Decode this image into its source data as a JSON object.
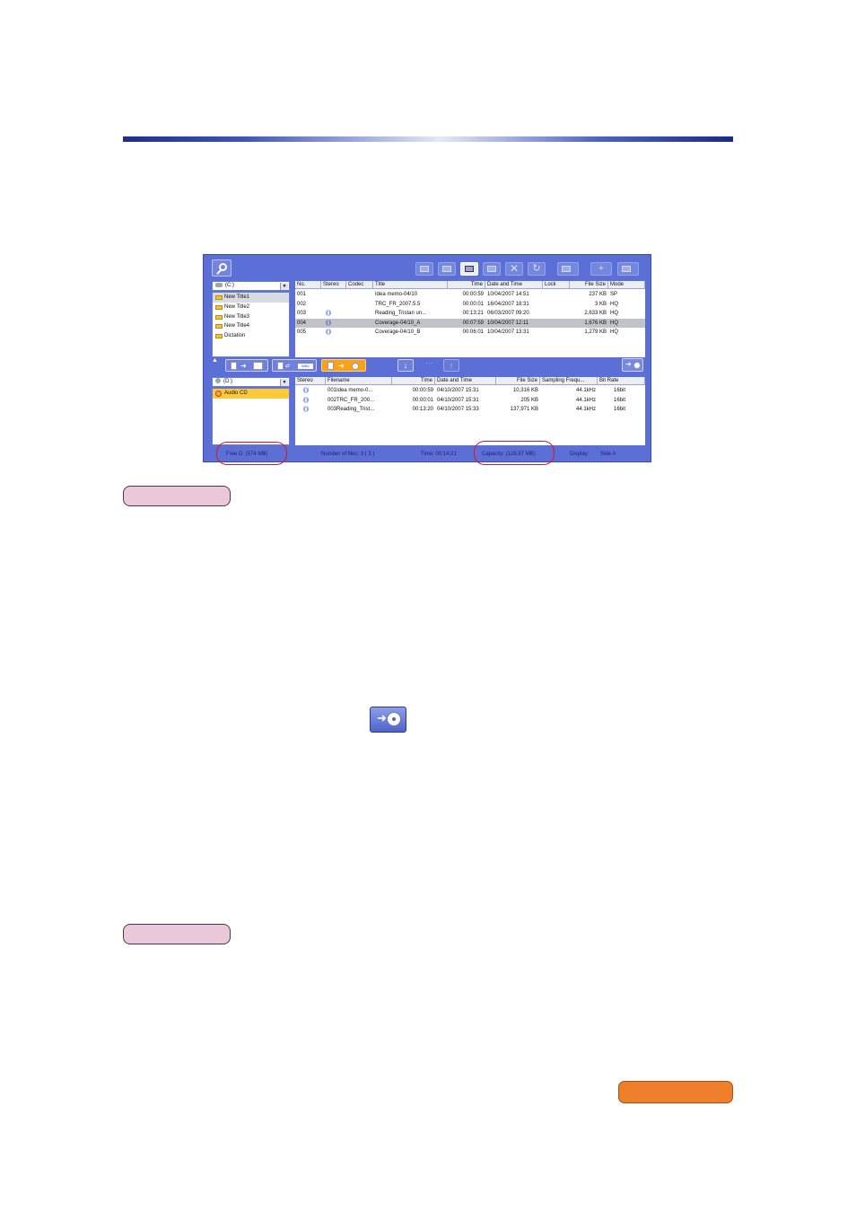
{
  "app": {
    "toolbar": {
      "search_icon": "search-icon",
      "buttons": [
        "copy-icon",
        "move-icon",
        "print-icon",
        "export-icon",
        "delete-icon",
        "refresh-icon",
        "split-icon",
        "add-icon",
        "title-icon"
      ]
    },
    "top": {
      "drive_label": "(C:)",
      "folders": [
        "New Title1",
        "New Title2",
        "New Title3",
        "New Title4",
        "Dictation"
      ],
      "columns": [
        "No.",
        "Stereo",
        "Codec",
        "Title",
        "Time",
        "Date and Time",
        "Lock",
        "File Size",
        "Mode"
      ],
      "rows": [
        {
          "no": "001",
          "stereo": "",
          "codec": "person",
          "title": "Idea memo-04/10",
          "time": "00:00:59",
          "date": "10/04/2007 14:51",
          "lock": "",
          "size": "237 KB",
          "mode": "SP",
          "selected": false
        },
        {
          "no": "002",
          "stereo": "",
          "codec": "bar",
          "title": "TRC_FR_2007.5.5",
          "time": "00:00:01",
          "date": "16/04/2007 18:31",
          "lock": "",
          "size": "3 KB",
          "mode": "HQ",
          "selected": false
        },
        {
          "no": "003",
          "stereo": "((·))",
          "codec": "bar",
          "title": "Reading_Tristan un...",
          "time": "00:13:21",
          "date": "06/03/2007 09:20",
          "lock": "",
          "size": "2,633 KB",
          "mode": "HQ",
          "selected": false
        },
        {
          "no": "004",
          "stereo": "((·))",
          "codec": "bar",
          "title": "Coverage-04/10_A",
          "time": "00:07:59",
          "date": "10/04/2007 12:11",
          "lock": "",
          "size": "1,676 KB",
          "mode": "HQ",
          "selected": true
        },
        {
          "no": "005",
          "stereo": "((·))",
          "codec": "bar",
          "title": "Coverage-04/10_B",
          "time": "00:06:01",
          "date": "10/04/2007 13:31",
          "lock": "",
          "size": "1,279 KB",
          "mode": "HQ",
          "selected": false
        }
      ]
    },
    "middle": {
      "wav_label": "WAV",
      "dots": "···"
    },
    "bottom": {
      "drive_label": "(D:)",
      "folders": [
        "Audio CD"
      ],
      "columns": [
        "Stereo",
        "Filename",
        "Time",
        "Date and Time",
        "File Size",
        "Sampling Frequ...",
        "Bit Rate"
      ],
      "rows": [
        {
          "stereo": "((·))",
          "filename": "001Idea memo-0...",
          "time": "00:00:59",
          "date": "04/10/2007 15:31",
          "size": "10,316 KB",
          "freq": "44.1kHz",
          "bits": "16bit"
        },
        {
          "stereo": "((·))",
          "filename": "002TRC_FR_200...",
          "time": "00:00:01",
          "date": "04/10/2007 15:31",
          "size": "205 KB",
          "freq": "44.1kHz",
          "bits": "16bit"
        },
        {
          "stereo": "((·))",
          "filename": "003Reading_Trist...",
          "time": "00:13:20",
          "date": "04/10/2007 15:33",
          "size": "137,971 KB",
          "freq": "44.1kHz",
          "bits": "16bit"
        }
      ]
    },
    "status": {
      "free": "Free D: (574 MB)",
      "files": "Number of files: 3 ( 3 )",
      "time": "Time: 00:14:21",
      "capacity": "Capacity:    (128.87 MB)",
      "display": "Display:",
      "side": "Side A"
    }
  },
  "colors": {
    "rule_dark": "#1e2f8a",
    "window_blue": "#5b6fd6",
    "highlight_orange": "#ffc93a",
    "note_pink": "#ebc8d9",
    "button_orange": "#ef7f2b",
    "oval_red": "#e0141c"
  }
}
